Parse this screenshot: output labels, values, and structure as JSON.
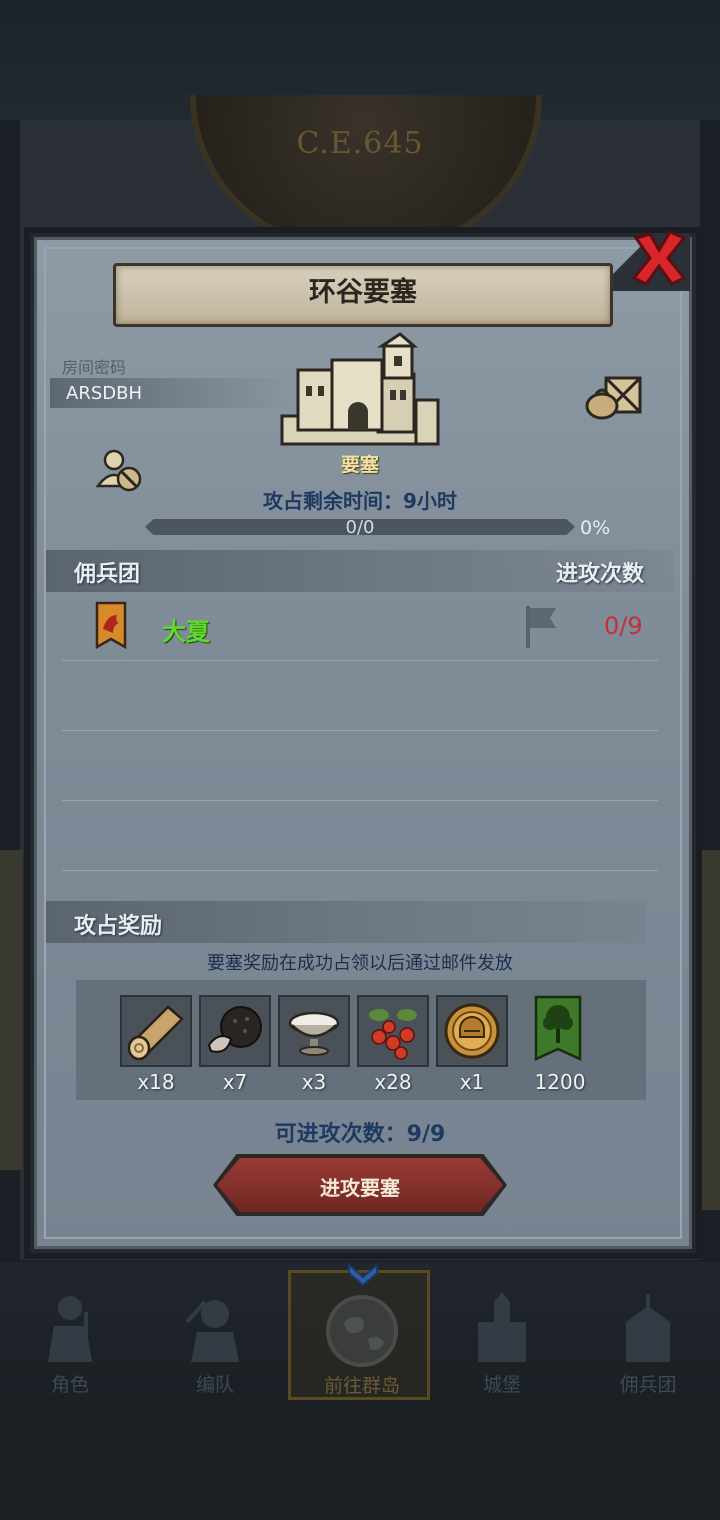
{
  "background": {
    "era_label": "C.E.645"
  },
  "dialog": {
    "title": "环谷要塞",
    "room": {
      "label": "房间密码",
      "code": "ARSDBH"
    },
    "fortress_label": "要塞",
    "remaining_time": "攻占剩余时间：9小时",
    "progress": {
      "text": "0/0",
      "percent_text": "0%",
      "fraction": 0
    },
    "mercenary_header": "佣兵团",
    "attack_count_header": "进攻次数",
    "mercenaries": [
      {
        "name": "大夏",
        "count": "0/9"
      }
    ],
    "reward_section_label": "攻占奖励",
    "reward_note": "要塞奖励在成功占领以后通过邮件发放",
    "rewards": [
      {
        "icon": "log-icon",
        "qty": "x18"
      },
      {
        "icon": "truffle-icon",
        "qty": "x7"
      },
      {
        "icon": "salt-bowl-icon",
        "qty": "x3"
      },
      {
        "icon": "berries-icon",
        "qty": "x28"
      },
      {
        "icon": "helmet-medal-icon",
        "qty": "x1"
      },
      {
        "icon": "green-banner-icon",
        "qty": "1200"
      }
    ],
    "attempts_text": "可进攻次数：9/9",
    "attack_button_label": "进攻要塞"
  },
  "bottom_nav": [
    {
      "label": "角色",
      "icon": "knight-icon"
    },
    {
      "label": "编队",
      "icon": "formation-icon"
    },
    {
      "label": "前往群岛",
      "icon": "world-map-icon",
      "active": true
    },
    {
      "label": "城堡",
      "icon": "castle-icon"
    },
    {
      "label": "佣兵团",
      "icon": "mercenary-icon"
    }
  ],
  "colors": {
    "title_text": "#2a2620",
    "mercenary_name": "#5edb2e",
    "attack_count": "#c42f3c",
    "attack_button": "#8a332e"
  }
}
